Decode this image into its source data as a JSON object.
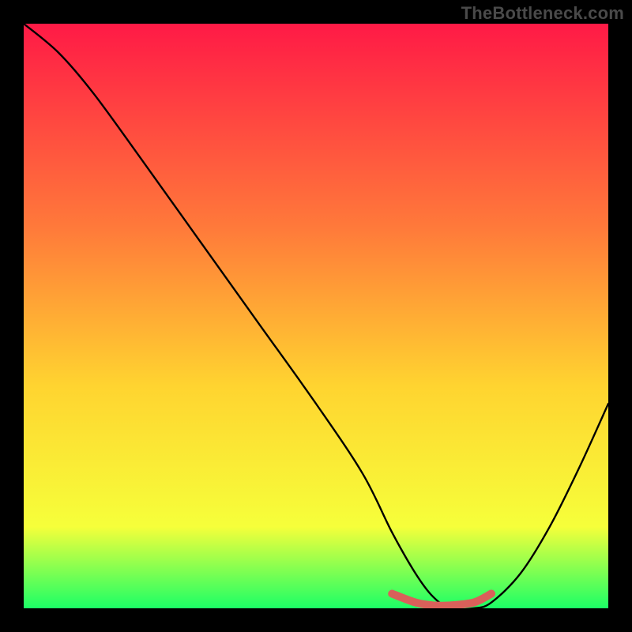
{
  "watermark": "TheBottleneck.com",
  "gradient": {
    "top": "#ff1a46",
    "mid_upper": "#ff7a3a",
    "mid": "#ffd430",
    "mid_lower": "#f6ff3a",
    "bottom": "#1cff66"
  },
  "curve_color": "#000000",
  "marker_color": "#d9605a",
  "chart_data": {
    "type": "line",
    "title": "",
    "xlabel": "",
    "ylabel": "",
    "xlim": [
      0,
      100
    ],
    "ylim": [
      0,
      100
    ],
    "series": [
      {
        "name": "bottleneck-curve",
        "x": [
          0,
          6,
          12,
          20,
          30,
          40,
          50,
          58,
          63,
          67,
          70,
          73,
          77,
          80,
          85,
          90,
          95,
          100
        ],
        "y": [
          100,
          95,
          88,
          77,
          63,
          49,
          35,
          23,
          13,
          6,
          2,
          0,
          0,
          1,
          6,
          14,
          24,
          35
        ]
      }
    ],
    "highlight_segment": {
      "x": [
        63,
        67,
        70,
        73,
        77,
        80
      ],
      "y": [
        2.5,
        1.0,
        0.5,
        0.5,
        1.0,
        2.5
      ]
    }
  }
}
